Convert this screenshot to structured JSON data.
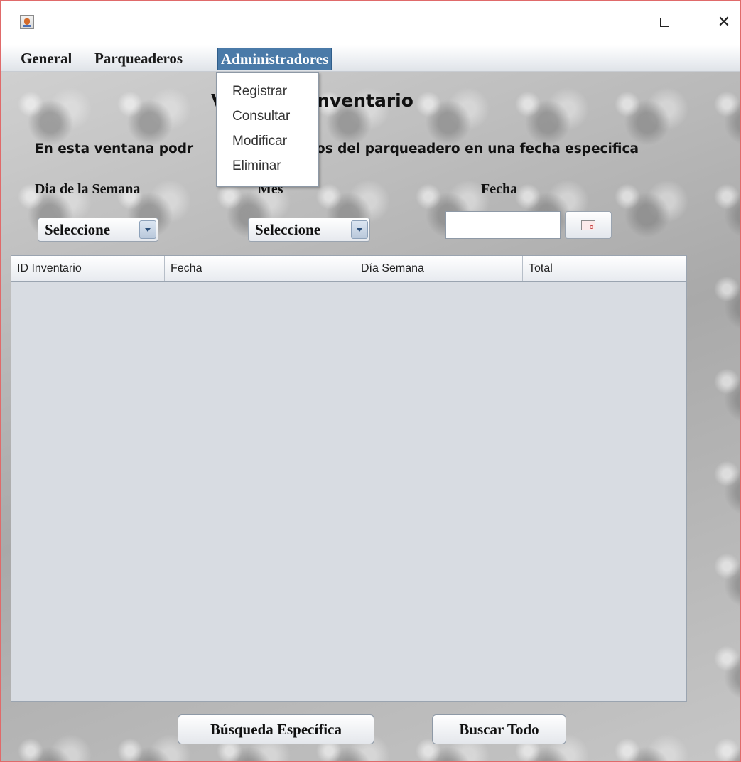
{
  "window": {
    "controls": {
      "minimize_icon": "minimize-icon",
      "maximize_icon": "maximize-icon",
      "close_label": "✕"
    }
  },
  "menubar": {
    "items": [
      {
        "label": "General"
      },
      {
        "label": "Parqueaderos"
      },
      {
        "label": "Administradores",
        "active": true
      }
    ]
  },
  "dropdown": {
    "items": [
      {
        "label": "Registrar"
      },
      {
        "label": "Consultar"
      },
      {
        "label": "Modificar"
      },
      {
        "label": "Eliminar"
      }
    ]
  },
  "main": {
    "heading": "V          le inventario",
    "description": "En esta ventana podr            os ingresos del parqueadero en una fecha especifica",
    "filters": {
      "day_label": "Dia de la Semana",
      "month_label": "Mes",
      "date_label": "Fecha",
      "day_select": "Seleccione",
      "month_select": "Seleccione",
      "date_value": "",
      "date_button_icon": "calendar-icon"
    },
    "table": {
      "columns": [
        "ID Inventario",
        "Fecha",
        "Día Semana",
        "Total"
      ],
      "rows": []
    },
    "buttons": {
      "specific": "Búsqueda Específica",
      "all": "Buscar Todo"
    }
  },
  "colors": {
    "menu_active": "#4a7aa8",
    "table_background": "#d8dce2",
    "window_border": "#e06a6a"
  }
}
